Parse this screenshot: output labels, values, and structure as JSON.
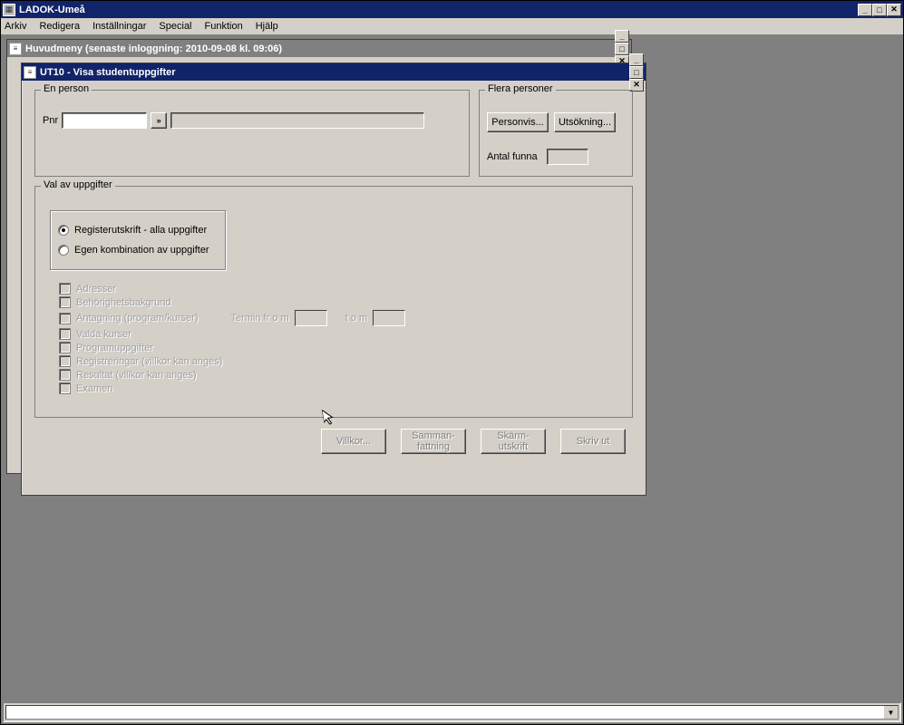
{
  "app": {
    "title": "LADOK-Umeå",
    "menu": [
      "Arkiv",
      "Redigera",
      "Inställningar",
      "Special",
      "Funktion",
      "Hjälp"
    ]
  },
  "windows": {
    "huvudmeny": {
      "title": "Huvudmeny   (senaste inloggning:  2010-09-08 kl. 09:06)"
    },
    "ut10": {
      "title": "UT10 - Visa studentuppgifter",
      "en_person": {
        "legend": "En person",
        "pnr_label": "Pnr",
        "pnr_value": "",
        "name_value": ""
      },
      "flera": {
        "legend": "Flera personer",
        "personvis_btn": "Personvis...",
        "utsokning_btn": "Utsökning...",
        "antal_label": "Antal funna",
        "antal_value": ""
      },
      "val": {
        "legend": "Val av uppgifter",
        "radio1": "Registerutskrift - alla uppgifter",
        "radio2": "Egen kombination av uppgifter",
        "checks": [
          "Adresser",
          "Behörighetsbakgrund",
          "Antagning (program/kurser)",
          "Valda kurser",
          "Programuppgifter",
          "Registreringar (villkor kan anges)",
          "Resultat (villkor kan anges)",
          "Examen"
        ],
        "termin_from_label": "Termin fr o m",
        "termin_to_label": "t o m"
      },
      "buttons": {
        "villkor": "Villkor...",
        "samman": "Samman-\nfattning",
        "skarm": "Skärm-\nutskrift",
        "skriv": "Skriv ut"
      }
    }
  }
}
